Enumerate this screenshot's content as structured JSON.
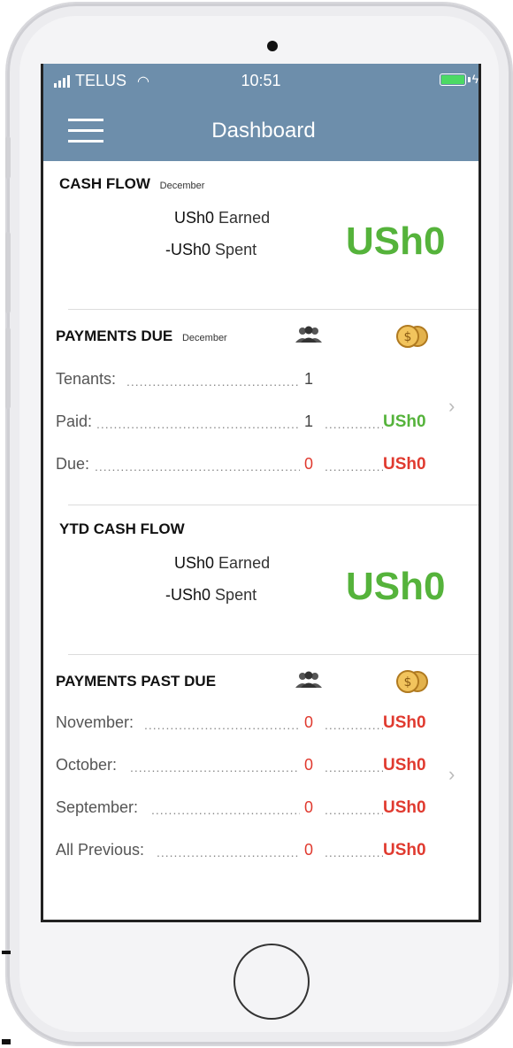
{
  "status_bar": {
    "carrier": "TELUS",
    "time": "10:51",
    "signal_icon": "signal-icon",
    "wifi_icon": "wifi-icon",
    "battery_icon": "battery-icon"
  },
  "nav": {
    "title": "Dashboard",
    "menu_icon": "hamburger-icon"
  },
  "cash_flow": {
    "title": "CASH FLOW",
    "month": "December",
    "earned_amount": "USh0",
    "earned_label": "Earned",
    "spent_amount": "-USh0",
    "spent_label": "Spent",
    "total": "USh0"
  },
  "payments_due": {
    "title": "PAYMENTS DUE",
    "month": "December",
    "rows": [
      {
        "label": "Tenants:",
        "count": "1",
        "amount": ""
      },
      {
        "label": "Paid:",
        "count": "1",
        "amount": "USh0"
      },
      {
        "label": "Due:",
        "count": "0",
        "amount": "USh0"
      }
    ]
  },
  "ytd_cash_flow": {
    "title": "YTD CASH FLOW",
    "earned_amount": "USh0",
    "earned_label": "Earned",
    "spent_amount": "-USh0",
    "spent_label": "Spent",
    "total": "USh0"
  },
  "payments_past_due": {
    "title": "PAYMENTS PAST DUE",
    "rows": [
      {
        "label": "November:",
        "count": "0",
        "amount": "USh0"
      },
      {
        "label": "October:",
        "count": "0",
        "amount": "USh0"
      },
      {
        "label": "September:",
        "count": "0",
        "amount": "USh0"
      },
      {
        "label": "All Previous:",
        "count": "0",
        "amount": "USh0"
      }
    ]
  },
  "colors": {
    "header": "#6d8eab",
    "positive": "#55b33b",
    "negative": "#e03a2f"
  }
}
